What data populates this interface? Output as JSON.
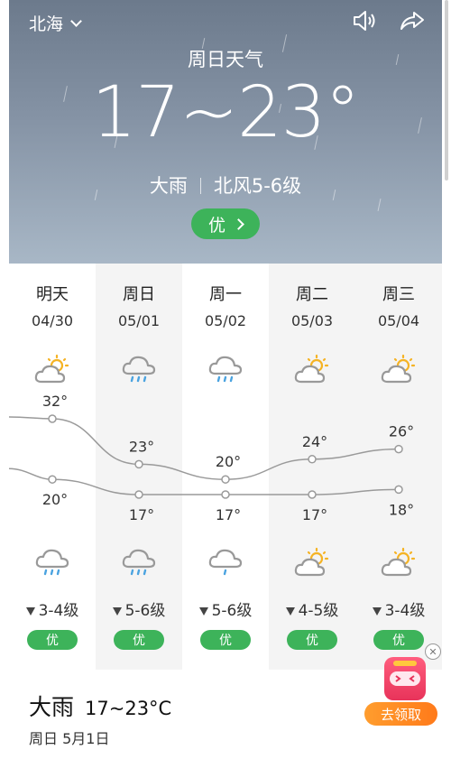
{
  "header": {
    "city": "北海",
    "title": "周日天气",
    "temp_range": "17~23°",
    "condition": "大雨",
    "wind": "北风5-6级",
    "aqi": "优"
  },
  "days": [
    {
      "day": "明天",
      "date": "04/30",
      "high": 32,
      "low": 20,
      "high_label": "32°",
      "low_label": "20°",
      "icon_day": "partly-cloudy-icon",
      "icon_night": "rain-icon",
      "wind": "3-4级",
      "aqi": "优"
    },
    {
      "day": "周日",
      "date": "05/01",
      "high": 23,
      "low": 17,
      "high_label": "23°",
      "low_label": "17°",
      "icon_day": "rain-icon",
      "icon_night": "rain-icon",
      "wind": "5-6级",
      "aqi": "优"
    },
    {
      "day": "周一",
      "date": "05/02",
      "high": 20,
      "low": 17,
      "high_label": "20°",
      "low_label": "17°",
      "icon_day": "rain-icon",
      "icon_night": "light-rain-icon",
      "wind": "5-6级",
      "aqi": "优"
    },
    {
      "day": "周二",
      "date": "05/03",
      "high": 24,
      "low": 17,
      "high_label": "24°",
      "low_label": "17°",
      "icon_day": "partly-cloudy-icon",
      "icon_night": "partly-cloudy-icon",
      "wind": "4-5级",
      "aqi": "优"
    },
    {
      "day": "周三",
      "date": "05/04",
      "high": 26,
      "low": 18,
      "high_label": "26°",
      "low_label": "18°",
      "icon_day": "partly-cloudy-icon",
      "icon_night": "partly-cloudy-icon",
      "wind": "3-4级",
      "aqi": "优"
    }
  ],
  "bottom": {
    "condition": "大雨",
    "temps": "17~23°C",
    "date": "周日  5月1日"
  },
  "promo": {
    "button": "去领取"
  },
  "colors": {
    "good_aqi": "#3db35a",
    "sun": "#f5b324",
    "rain": "#4aa3e0",
    "promo": "#ff8a25"
  }
}
